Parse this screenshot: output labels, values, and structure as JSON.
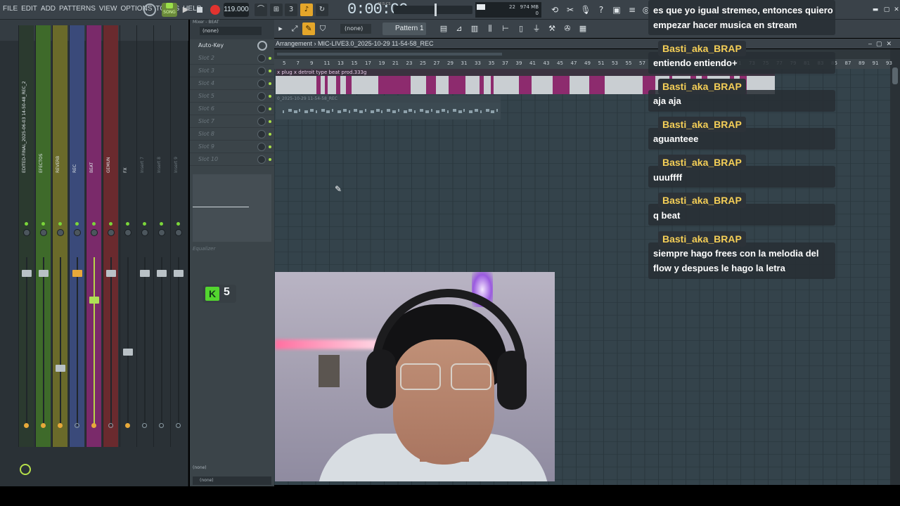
{
  "toolbar": {
    "menu": [
      "FILE",
      "EDIT",
      "ADD",
      "PATTERNS",
      "VIEW",
      "OPTIONS",
      "TOOLS",
      "HELP"
    ],
    "song_mode": "SONG",
    "tempo": "119.000",
    "time": "0:00:00",
    "time_unit": "M:S:CS",
    "ram": "974 MB",
    "polyphony": "22",
    "cpu_zero": "0"
  },
  "mixer": {
    "title": "Mixer - BEAT",
    "tracks": [
      {
        "label": "EDITED-FINAL_2025-06-03 14-50-48_REC_2"
      },
      {
        "label": "EFECTOS"
      },
      {
        "label": "REVERB"
      },
      {
        "label": "REC"
      },
      {
        "label": "BEAT"
      },
      {
        "label": "GEMUN"
      },
      {
        "label": "FX"
      },
      {
        "label": "Insert 7"
      },
      {
        "label": "Insert 8"
      },
      {
        "label": "Insert 9"
      }
    ]
  },
  "slots_panel": {
    "preset": "(none)",
    "auto_key": "Auto-Key",
    "slots": [
      "Slot 2",
      "Slot 3",
      "Slot 4",
      "Slot 5",
      "Slot 6",
      "Slot 7",
      "Slot 8",
      "Slot 9",
      "Slot 10"
    ],
    "equalizer": "Equalizer",
    "route_1": "(none)",
    "route_2": "(none)"
  },
  "kick_badge": {
    "letter": "K",
    "count": "5"
  },
  "playlist": {
    "snap": "(none)",
    "pattern": "Pattern 1",
    "title": "Arrangement",
    "project": "MIC-LIVE3.0_2025-10-29 11-54-58_REC",
    "ruler": [
      "5",
      "7",
      "9",
      "11",
      "13",
      "15",
      "17",
      "19",
      "21",
      "23",
      "25",
      "27",
      "29",
      "31",
      "33",
      "35",
      "37",
      "39",
      "41",
      "43",
      "45",
      "47",
      "49",
      "51",
      "53",
      "55",
      "57",
      "59",
      "61",
      "63",
      "65",
      "67",
      "69",
      "71",
      "73",
      "75",
      "77",
      "79",
      "81",
      "83",
      "85",
      "87",
      "89",
      "91",
      "93"
    ],
    "clip1": "x plug x detroit type beat  prod.333g",
    "clip2": "0_2025-10-29 11-54-58_REC"
  },
  "chat": [
    {
      "user": "",
      "text": "es que yo igual stremeo, entonces quiero empezar hacer musica en stream"
    },
    {
      "user": "Basti_aka_BRAP",
      "text": "entiendo entiendo+"
    },
    {
      "user": "Basti_aka_BRAP",
      "text": "aja aja"
    },
    {
      "user": "Basti_aka_BRAP",
      "text": "aguanteee"
    },
    {
      "user": "Basti_aka_BRAP",
      "text": "uuuffff"
    },
    {
      "user": "Basti_aka_BRAP",
      "text": "q beat"
    },
    {
      "user": "Basti_aka_BRAP",
      "text": "siempre hago frees con la melodia del flow y despues le hago la letra"
    }
  ],
  "colors": {
    "accent": "#e4a62a",
    "record": "#e2332f",
    "chat_user": "#f5cf57",
    "clip": "#8d2b6e"
  }
}
